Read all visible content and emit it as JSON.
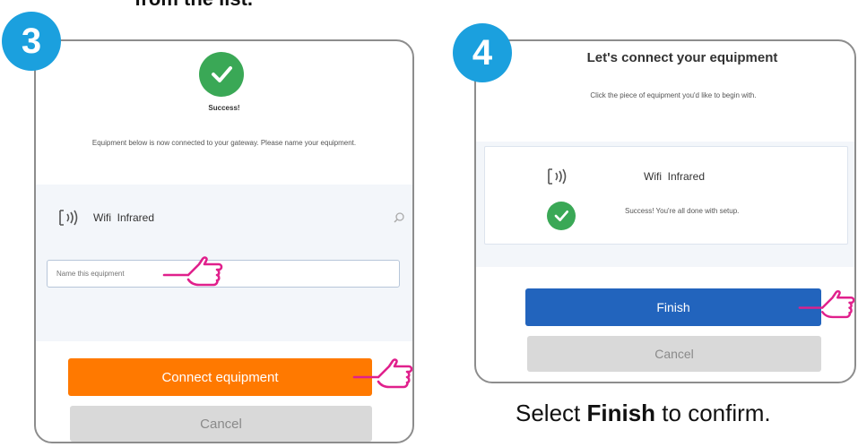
{
  "top_caption": "from the list.",
  "step3": {
    "badge": "3",
    "success_title": "Success!",
    "message": "Equipment below is now connected to your gateway. Please name your equipment.",
    "device_name": "Wifi  Infrared",
    "name_input_placeholder": "Name this equipment",
    "connect_label": "Connect equipment",
    "cancel_label": "Cancel"
  },
  "step4": {
    "badge": "4",
    "title": "Let's connect your equipment",
    "subtitle": "Click the piece of equipment you'd like to begin with.",
    "device_name": "Wifi  Infrared",
    "status": "Success! You're all done with setup.",
    "finish_label": "Finish",
    "cancel_label": "Cancel"
  },
  "caption": {
    "prefix": "Select ",
    "bold": "Finish",
    "suffix": " to confirm."
  },
  "icons": [
    "check-icon",
    "wifi-infrared-icon",
    "search-icon",
    "pointing-hand-icon"
  ],
  "colors": {
    "badge": "#1ba0de",
    "success_green": "#3aa856",
    "connect_orange": "#ff7900",
    "finish_blue": "#2264bd",
    "cancel_gray": "#d9d9d9",
    "hand_pink": "#e0208c"
  }
}
